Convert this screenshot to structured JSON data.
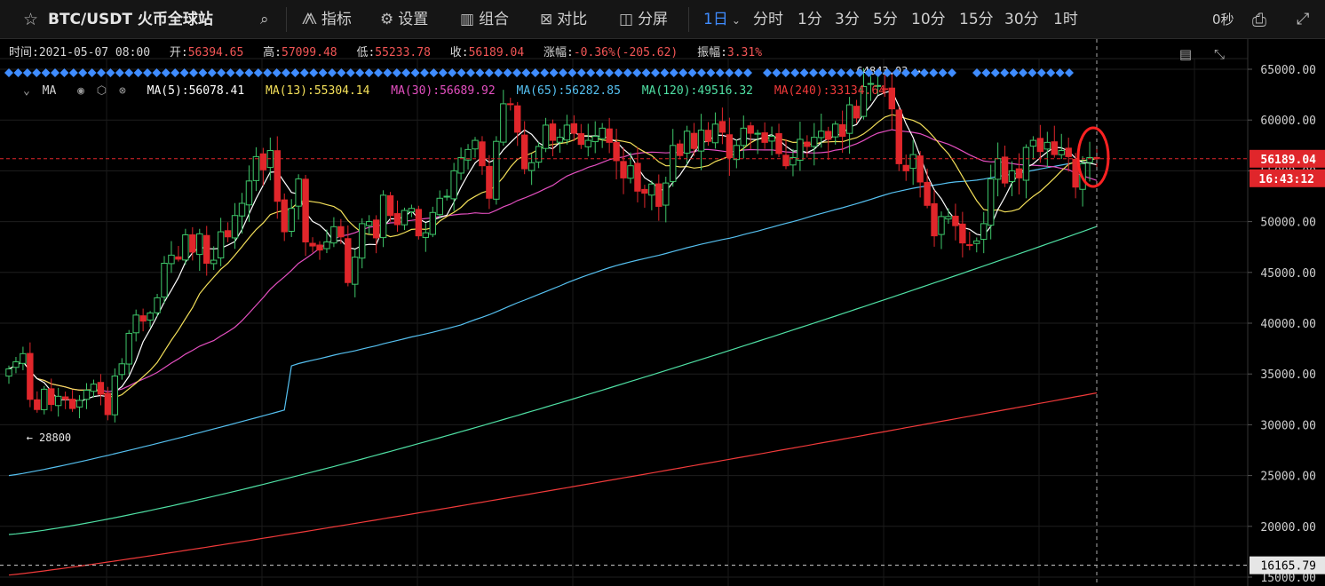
{
  "toolbar": {
    "symbol": "BTC/USDT 火币全球站",
    "indicators": "指标",
    "settings": "设置",
    "combo": "组合",
    "compare": "对比",
    "split": "分屏",
    "interval_selected": "1日",
    "intervals": [
      "分时",
      "1分",
      "3分",
      "5分",
      "10分",
      "15分",
      "30分",
      "1时"
    ],
    "countdown": "0秒"
  },
  "ohlc": {
    "time_label": "时间:",
    "time": "2021-05-07 08:00",
    "open_label": "开:",
    "open": "56394.65",
    "high_label": "高:",
    "high": "57099.48",
    "low_label": "低:",
    "low": "55233.78",
    "close_label": "收:",
    "close": "56189.04",
    "change_label": "涨幅:",
    "change": "-0.36%(-205.62)",
    "amplitude_label": "振幅:",
    "amplitude": "3.31%"
  },
  "ma_legend": {
    "title": "MA",
    "items": [
      {
        "label": "MA(5):56078.41",
        "color": "#ffffff"
      },
      {
        "label": "MA(13):55304.14",
        "color": "#f5e15a"
      },
      {
        "label": "MA(30):56689.92",
        "color": "#e44fc0"
      },
      {
        "label": "MA(65):56282.85",
        "color": "#55c0f0"
      },
      {
        "label": "MA(120):49516.32",
        "color": "#4fe0a4"
      },
      {
        "label": "MA(240):33134.64",
        "color": "#f03a3a"
      }
    ]
  },
  "chart_data": {
    "type": "candlestick",
    "ylim": [
      15000,
      67500
    ],
    "y_ticks": [
      "65000.00",
      "60000.00",
      "55000.00",
      "50000.00",
      "45000.00",
      "40000.00",
      "35000.00",
      "30000.00",
      "25000.00",
      "20000.00",
      "15000.00"
    ],
    "y_tick_values": [
      65000,
      60000,
      55000,
      50000,
      45000,
      40000,
      35000,
      30000,
      25000,
      20000,
      15000
    ],
    "current_price": "56189.04",
    "current_value": 56189.04,
    "countdown_tag": "16:43:12",
    "low_marker": "16165.79",
    "low_value": 16165.79,
    "annotation_min": "← 28800",
    "annotation_min_value": 28800,
    "annotation_max": "64843.03 →",
    "annotation_max_value": 64843.03,
    "ma_colors": [
      "#ffffff",
      "#f5e15a",
      "#e44fc0",
      "#55c0f0",
      "#4fe0a4",
      "#f03a3a"
    ],
    "up_color": "#3ec76a",
    "down_color": "#e0262b",
    "close": [
      35500,
      36200,
      37000,
      32500,
      31500,
      33500,
      32000,
      32800,
      32500,
      31600,
      32400,
      33400,
      34000,
      33000,
      31000,
      34800,
      36000,
      39000,
      40800,
      40200,
      41000,
      42500,
      45900,
      46700,
      46300,
      48700,
      47000,
      48800,
      45900,
      46200,
      49000,
      48500,
      50600,
      51800,
      54000,
      56400,
      55100,
      57000,
      52000,
      49000,
      51300,
      54200,
      48000,
      47600,
      47200,
      48000,
      49500,
      48500,
      44000,
      46500,
      49800,
      50000,
      48400,
      52600,
      50600,
      49700,
      51100,
      51300,
      48600,
      48900,
      50900,
      52300,
      52500,
      55000,
      56300,
      57100,
      58000,
      55500,
      52300,
      57900,
      61600,
      61600,
      58800,
      55200,
      55800,
      57400,
      59500,
      58000,
      58300,
      59500,
      58700,
      57600,
      58000,
      58400,
      59200,
      57800,
      56000,
      54300,
      55500,
      53000,
      52800,
      53700,
      51500,
      53800,
      57500,
      56500,
      58900,
      57200,
      59000,
      57900,
      59600,
      58800,
      56300,
      57500,
      59200,
      58700,
      58700,
      57800,
      58400,
      56700,
      55500,
      56300,
      58100,
      57400,
      58300,
      58900,
      58100,
      59600,
      58400,
      61500,
      60200,
      63300,
      63600,
      63400,
      63000,
      61100,
      55700,
      55000,
      56600,
      53900,
      51600,
      48600,
      50500,
      50500,
      49600,
      47900,
      47700,
      48100,
      49800,
      54200,
      56200,
      53800,
      55000,
      54300,
      57300,
      58000,
      56900,
      57800,
      56600,
      57000,
      56400,
      53400,
      55700,
      56300,
      56189
    ],
    "ma120": [
      null,
      null,
      null,
      null,
      null,
      null,
      null,
      null,
      null,
      null,
      null,
      null,
      null,
      null,
      null,
      null,
      null,
      null,
      null,
      null,
      null,
      null,
      null,
      null,
      null,
      null,
      null,
      null,
      null,
      null,
      null,
      null,
      null,
      null,
      null,
      null,
      null,
      null,
      null,
      null,
      null,
      null,
      null,
      null,
      null,
      null,
      null,
      null,
      null,
      null,
      null,
      null,
      null,
      null,
      null,
      null,
      null,
      null,
      null,
      null,
      null,
      null,
      null,
      null,
      null,
      null,
      null,
      null,
      null,
      null,
      null,
      null,
      null,
      null,
      null,
      null,
      null,
      null,
      null,
      null,
      null,
      null,
      null,
      null,
      null,
      null,
      null,
      null,
      null,
      null,
      null,
      null,
      null,
      null,
      null,
      null,
      null,
      null,
      null,
      null,
      null,
      null,
      null,
      null,
      null,
      null,
      null,
      null,
      null,
      null,
      null,
      null,
      null,
      null,
      null,
      null,
      null,
      null,
      null,
      null,
      null,
      null,
      null,
      null,
      null,
      null,
      null,
      null,
      null,
      null,
      null,
      null,
      null,
      null,
      null,
      null,
      null,
      null,
      null,
      null,
      null,
      null,
      null,
      null,
      null,
      null,
      null,
      null,
      null,
      null,
      null,
      null,
      null,
      null,
      49516
    ],
    "ma240": [
      null,
      null,
      null,
      null,
      null,
      null,
      null,
      null,
      null,
      null,
      null,
      null,
      null,
      null,
      null,
      null,
      null,
      null,
      null,
      null,
      null,
      null,
      null,
      null,
      null,
      null,
      null,
      null,
      null,
      null,
      null,
      null,
      null,
      null,
      null,
      null,
      null,
      null,
      null,
      null,
      null,
      null,
      null,
      null,
      null,
      null,
      null,
      null,
      null,
      null,
      null,
      null,
      null,
      null,
      null,
      null,
      null,
      null,
      null,
      null,
      null,
      null,
      null,
      null,
      null,
      null,
      null,
      null,
      null,
      null,
      null,
      null,
      null,
      null,
      null,
      null,
      null,
      null,
      null,
      null,
      null,
      null,
      null,
      null,
      null,
      null,
      null,
      null,
      null,
      null,
      null,
      null,
      null,
      null,
      null,
      null,
      null,
      null,
      null,
      null,
      null,
      null,
      null,
      null,
      null,
      null,
      null,
      null,
      null,
      null,
      null,
      null,
      null,
      null,
      null,
      null,
      null,
      null,
      null,
      null,
      null,
      null,
      null,
      null,
      null,
      null,
      null,
      null,
      null,
      null,
      null,
      null,
      null,
      null,
      null,
      null,
      null,
      null,
      null,
      null,
      null,
      null,
      null,
      null,
      null,
      null,
      null,
      null,
      null,
      null,
      null,
      null,
      null,
      null,
      33134
    ]
  }
}
